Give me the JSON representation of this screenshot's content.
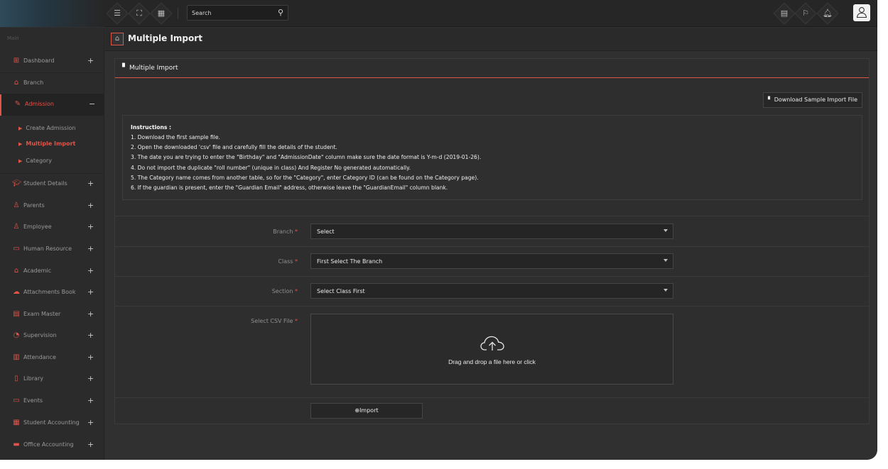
{
  "topbar": {
    "brand_text": "",
    "search_placeholder": "Search",
    "icons": [
      "menu-icon",
      "fullscreen-icon",
      "apps-grid-icon",
      "calendar-icon",
      "flag-icon",
      "bell-icon",
      "user-icon"
    ]
  },
  "sidebar": {
    "section": "Main",
    "items": [
      {
        "label": "Dashboard",
        "icon": "dashboard-icon",
        "toggle": "+"
      },
      {
        "label": "Branch",
        "icon": "branch-icon",
        "toggle": ""
      },
      {
        "label": "Admission",
        "icon": "admission-icon",
        "toggle": "−"
      },
      {
        "label": "Student Details",
        "icon": "student-icon",
        "toggle": "+"
      },
      {
        "label": "Parents",
        "icon": "parents-icon",
        "toggle": "+"
      },
      {
        "label": "Employee",
        "icon": "employee-icon",
        "toggle": "+"
      },
      {
        "label": "Human Resource",
        "icon": "hr-icon",
        "toggle": "+"
      },
      {
        "label": "Academic",
        "icon": "academic-icon",
        "toggle": "+"
      },
      {
        "label": "Attachments Book",
        "icon": "attachments-icon",
        "toggle": "+"
      },
      {
        "label": "Exam Master",
        "icon": "exam-icon",
        "toggle": "+"
      },
      {
        "label": "Supervision",
        "icon": "supervision-icon",
        "toggle": "+"
      },
      {
        "label": "Attendance",
        "icon": "attendance-icon",
        "toggle": "+"
      },
      {
        "label": "Library",
        "icon": "library-icon",
        "toggle": "+"
      },
      {
        "label": "Events",
        "icon": "events-icon",
        "toggle": "+"
      },
      {
        "label": "Student Accounting",
        "icon": "student-accounting-icon",
        "toggle": "+"
      },
      {
        "label": "Office Accounting",
        "icon": "office-accounting-icon",
        "toggle": "+"
      }
    ],
    "subitems": [
      {
        "label": "Create Admission"
      },
      {
        "label": "Multiple Import"
      },
      {
        "label": "Category"
      }
    ]
  },
  "page": {
    "title": "Multiple Import"
  },
  "panel": {
    "title": "Multiple Import",
    "download_label": "Download Sample Import File",
    "instructions_title": "Instructions :",
    "instructions": [
      "1. Download the first sample file.",
      "2. Open the downloaded 'csv' file and carefully fill the details of the student.",
      "3. The date you are trying to enter the \"Birthday\" and \"AdmissionDate\" column make sure the date format is Y-m-d (2019-01-26).",
      "4. Do not import the duplicate \"roll number\" (unique in class) And Register No generated automatically.",
      "5. The Category name comes from another table, so for the \"Category\", enter Category ID (can be found on the Category page).",
      "6. If the guardian is present, enter the \"Guardian Email\" address, otherwise leave the \"GuardianEmail\" column blank."
    ]
  },
  "form": {
    "required_mark": "*",
    "branch": {
      "label": "Branch",
      "value": "Select"
    },
    "class": {
      "label": "Class",
      "value": "First Select The Branch"
    },
    "section": {
      "label": "Section",
      "value": "Select Class First"
    },
    "csv": {
      "label": "Select CSV File",
      "dropzone_text": "Drag and drop a file here or click"
    },
    "import_label": "Import"
  },
  "colors": {
    "accent": "#e0544a",
    "background": "#303030",
    "sidebar": "#2b2b2b"
  }
}
